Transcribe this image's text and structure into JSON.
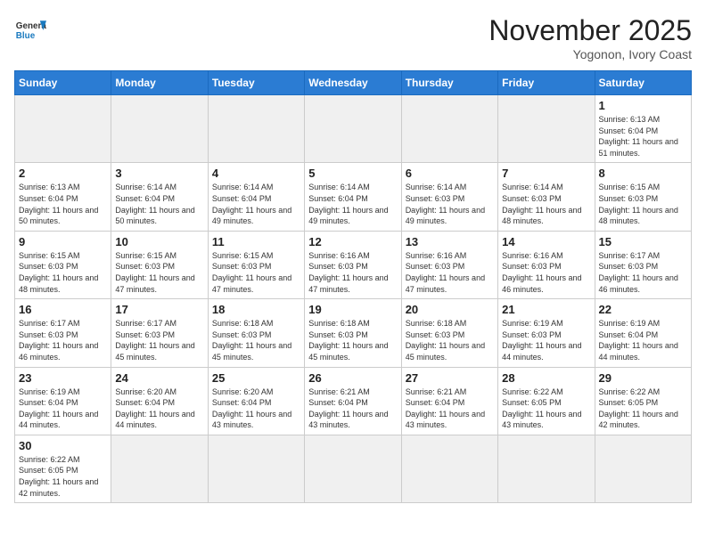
{
  "header": {
    "logo_general": "General",
    "logo_blue": "Blue",
    "title": "November 2025",
    "subtitle": "Yogonon, Ivory Coast"
  },
  "weekdays": [
    "Sunday",
    "Monday",
    "Tuesday",
    "Wednesday",
    "Thursday",
    "Friday",
    "Saturday"
  ],
  "days": [
    {
      "num": "",
      "info": ""
    },
    {
      "num": "",
      "info": ""
    },
    {
      "num": "",
      "info": ""
    },
    {
      "num": "",
      "info": ""
    },
    {
      "num": "",
      "info": ""
    },
    {
      "num": "",
      "info": ""
    },
    {
      "num": "1",
      "info": "Sunrise: 6:13 AM\nSunset: 6:04 PM\nDaylight: 11 hours and 51 minutes."
    },
    {
      "num": "2",
      "info": "Sunrise: 6:13 AM\nSunset: 6:04 PM\nDaylight: 11 hours and 50 minutes."
    },
    {
      "num": "3",
      "info": "Sunrise: 6:14 AM\nSunset: 6:04 PM\nDaylight: 11 hours and 50 minutes."
    },
    {
      "num": "4",
      "info": "Sunrise: 6:14 AM\nSunset: 6:04 PM\nDaylight: 11 hours and 49 minutes."
    },
    {
      "num": "5",
      "info": "Sunrise: 6:14 AM\nSunset: 6:04 PM\nDaylight: 11 hours and 49 minutes."
    },
    {
      "num": "6",
      "info": "Sunrise: 6:14 AM\nSunset: 6:03 PM\nDaylight: 11 hours and 49 minutes."
    },
    {
      "num": "7",
      "info": "Sunrise: 6:14 AM\nSunset: 6:03 PM\nDaylight: 11 hours and 48 minutes."
    },
    {
      "num": "8",
      "info": "Sunrise: 6:15 AM\nSunset: 6:03 PM\nDaylight: 11 hours and 48 minutes."
    },
    {
      "num": "9",
      "info": "Sunrise: 6:15 AM\nSunset: 6:03 PM\nDaylight: 11 hours and 48 minutes."
    },
    {
      "num": "10",
      "info": "Sunrise: 6:15 AM\nSunset: 6:03 PM\nDaylight: 11 hours and 47 minutes."
    },
    {
      "num": "11",
      "info": "Sunrise: 6:15 AM\nSunset: 6:03 PM\nDaylight: 11 hours and 47 minutes."
    },
    {
      "num": "12",
      "info": "Sunrise: 6:16 AM\nSunset: 6:03 PM\nDaylight: 11 hours and 47 minutes."
    },
    {
      "num": "13",
      "info": "Sunrise: 6:16 AM\nSunset: 6:03 PM\nDaylight: 11 hours and 47 minutes."
    },
    {
      "num": "14",
      "info": "Sunrise: 6:16 AM\nSunset: 6:03 PM\nDaylight: 11 hours and 46 minutes."
    },
    {
      "num": "15",
      "info": "Sunrise: 6:17 AM\nSunset: 6:03 PM\nDaylight: 11 hours and 46 minutes."
    },
    {
      "num": "16",
      "info": "Sunrise: 6:17 AM\nSunset: 6:03 PM\nDaylight: 11 hours and 46 minutes."
    },
    {
      "num": "17",
      "info": "Sunrise: 6:17 AM\nSunset: 6:03 PM\nDaylight: 11 hours and 45 minutes."
    },
    {
      "num": "18",
      "info": "Sunrise: 6:18 AM\nSunset: 6:03 PM\nDaylight: 11 hours and 45 minutes."
    },
    {
      "num": "19",
      "info": "Sunrise: 6:18 AM\nSunset: 6:03 PM\nDaylight: 11 hours and 45 minutes."
    },
    {
      "num": "20",
      "info": "Sunrise: 6:18 AM\nSunset: 6:03 PM\nDaylight: 11 hours and 45 minutes."
    },
    {
      "num": "21",
      "info": "Sunrise: 6:19 AM\nSunset: 6:03 PM\nDaylight: 11 hours and 44 minutes."
    },
    {
      "num": "22",
      "info": "Sunrise: 6:19 AM\nSunset: 6:04 PM\nDaylight: 11 hours and 44 minutes."
    },
    {
      "num": "23",
      "info": "Sunrise: 6:19 AM\nSunset: 6:04 PM\nDaylight: 11 hours and 44 minutes."
    },
    {
      "num": "24",
      "info": "Sunrise: 6:20 AM\nSunset: 6:04 PM\nDaylight: 11 hours and 44 minutes."
    },
    {
      "num": "25",
      "info": "Sunrise: 6:20 AM\nSunset: 6:04 PM\nDaylight: 11 hours and 43 minutes."
    },
    {
      "num": "26",
      "info": "Sunrise: 6:21 AM\nSunset: 6:04 PM\nDaylight: 11 hours and 43 minutes."
    },
    {
      "num": "27",
      "info": "Sunrise: 6:21 AM\nSunset: 6:04 PM\nDaylight: 11 hours and 43 minutes."
    },
    {
      "num": "28",
      "info": "Sunrise: 6:22 AM\nSunset: 6:05 PM\nDaylight: 11 hours and 43 minutes."
    },
    {
      "num": "29",
      "info": "Sunrise: 6:22 AM\nSunset: 6:05 PM\nDaylight: 11 hours and 42 minutes."
    },
    {
      "num": "30",
      "info": "Sunrise: 6:22 AM\nSunset: 6:05 PM\nDaylight: 11 hours and 42 minutes."
    },
    {
      "num": "",
      "info": ""
    },
    {
      "num": "",
      "info": ""
    },
    {
      "num": "",
      "info": ""
    },
    {
      "num": "",
      "info": ""
    },
    {
      "num": "",
      "info": ""
    }
  ]
}
